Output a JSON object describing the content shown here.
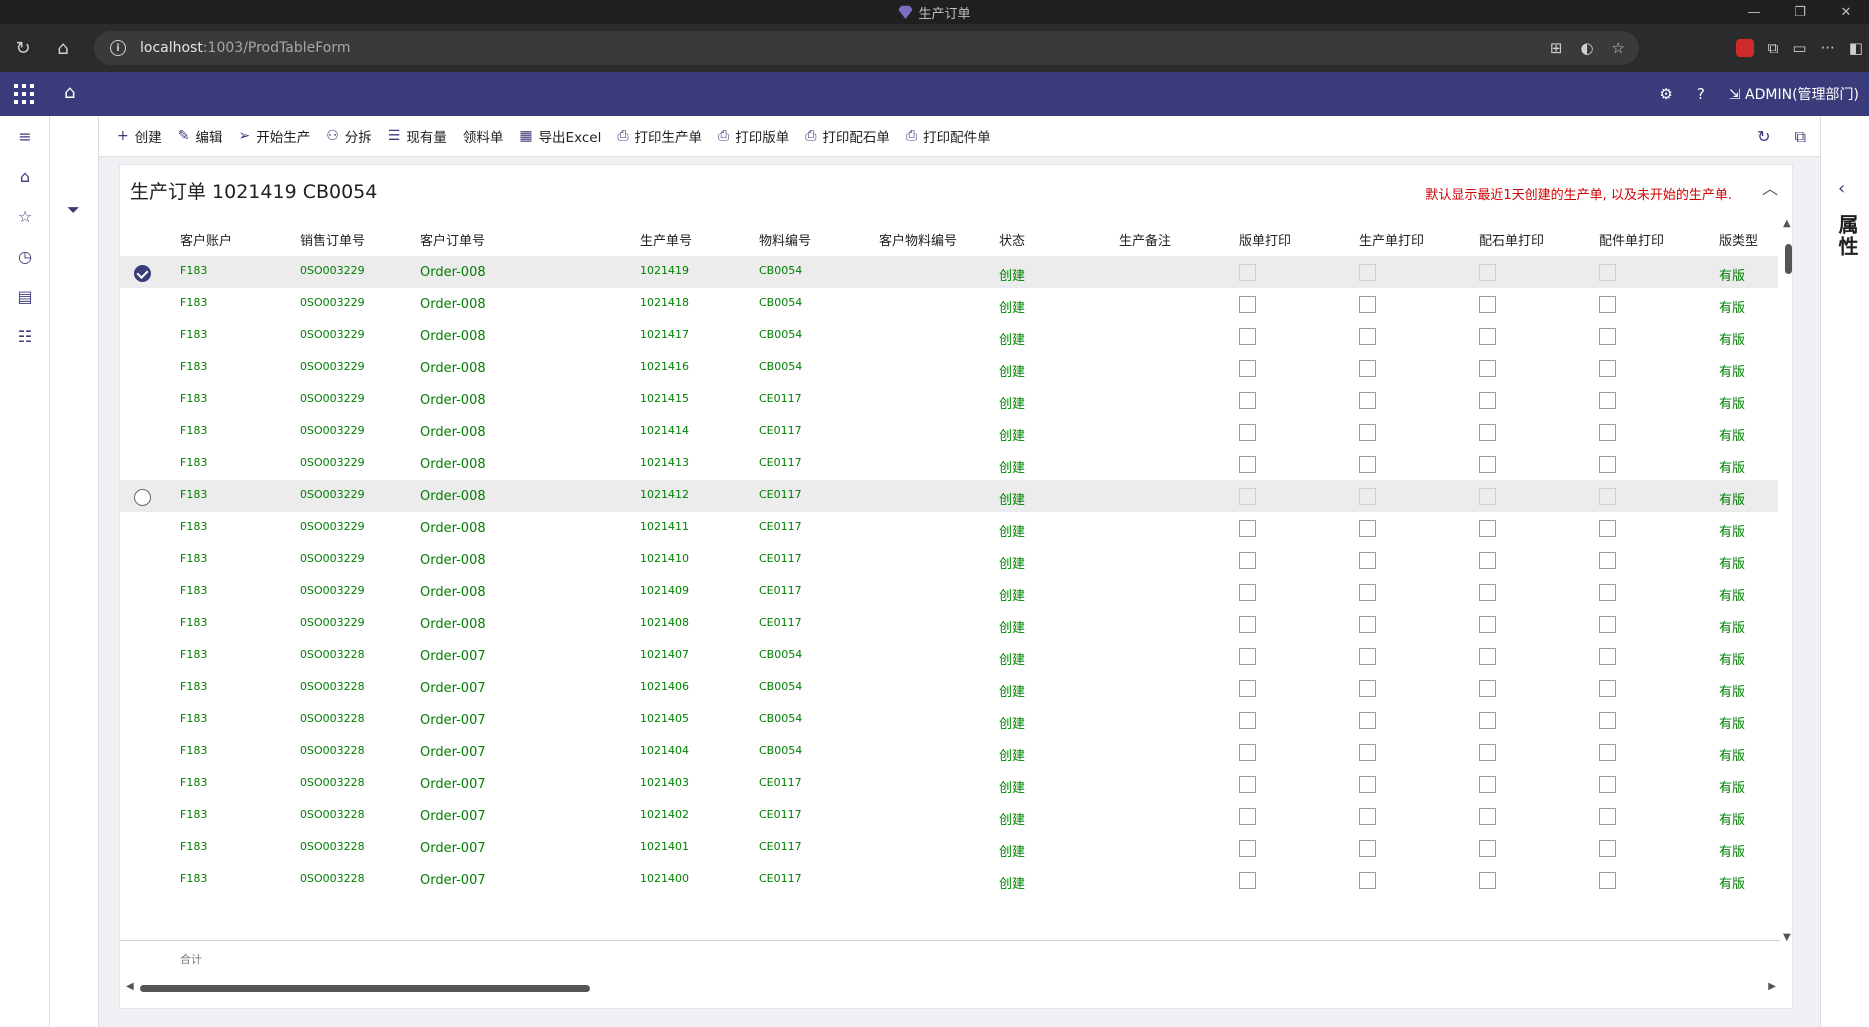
{
  "browser": {
    "window_title": "生产订单",
    "url_host": "localhost",
    "url_rest": ":1003/ProdTableForm"
  },
  "header": {
    "user": "ADMIN(管理部门)"
  },
  "actions": [
    {
      "label": "创建",
      "icon": "plus-icon",
      "glyph": "+"
    },
    {
      "label": "编辑",
      "icon": "pencil-icon",
      "glyph": "✎"
    },
    {
      "label": "开始生产",
      "icon": "send-icon",
      "glyph": "➢"
    },
    {
      "label": "分拆",
      "icon": "split-icon",
      "glyph": "⚇"
    },
    {
      "label": "现有量",
      "icon": "stock-icon",
      "glyph": "☰"
    },
    {
      "label": "领料单",
      "icon": "",
      "glyph": ""
    },
    {
      "label": "导出Excel",
      "icon": "excel-icon",
      "glyph": "▦"
    },
    {
      "label": "打印生产单",
      "icon": "print-icon",
      "glyph": "⎙"
    },
    {
      "label": "打印版单",
      "icon": "print-icon",
      "glyph": "⎙"
    },
    {
      "label": "打印配石单",
      "icon": "print-icon",
      "glyph": "⎙"
    },
    {
      "label": "打印配件单",
      "icon": "print-icon",
      "glyph": "⎙"
    }
  ],
  "right_pane_label": "属性",
  "form": {
    "title": "生产订单 1021419 CB0054",
    "notice": "默认显示最近1天创建的生产单, 以及未开始的生产单."
  },
  "columns": [
    "客户账户",
    "销售订单号",
    "客户订单号",
    "生产单号",
    "物料编号",
    "客户物料编号",
    "状态",
    "生产备注",
    "版单打印",
    "生产单打印",
    "配石单打印",
    "配件单打印",
    "版类型"
  ],
  "rows": [
    {
      "acct": "F183",
      "so": "0SO003229",
      "cust_order": "Order-008",
      "prod_no": "1021419",
      "item": "CB0054",
      "status": "创建",
      "type": "有版"
    },
    {
      "acct": "F183",
      "so": "0SO003229",
      "cust_order": "Order-008",
      "prod_no": "1021418",
      "item": "CB0054",
      "status": "创建",
      "type": "有版"
    },
    {
      "acct": "F183",
      "so": "0SO003229",
      "cust_order": "Order-008",
      "prod_no": "1021417",
      "item": "CB0054",
      "status": "创建",
      "type": "有版"
    },
    {
      "acct": "F183",
      "so": "0SO003229",
      "cust_order": "Order-008",
      "prod_no": "1021416",
      "item": "CB0054",
      "status": "创建",
      "type": "有版"
    },
    {
      "acct": "F183",
      "so": "0SO003229",
      "cust_order": "Order-008",
      "prod_no": "1021415",
      "item": "CE0117",
      "status": "创建",
      "type": "有版"
    },
    {
      "acct": "F183",
      "so": "0SO003229",
      "cust_order": "Order-008",
      "prod_no": "1021414",
      "item": "CE0117",
      "status": "创建",
      "type": "有版"
    },
    {
      "acct": "F183",
      "so": "0SO003229",
      "cust_order": "Order-008",
      "prod_no": "1021413",
      "item": "CE0117",
      "status": "创建",
      "type": "有版"
    },
    {
      "acct": "F183",
      "so": "0SO003229",
      "cust_order": "Order-008",
      "prod_no": "1021412",
      "item": "CE0117",
      "status": "创建",
      "type": "有版"
    },
    {
      "acct": "F183",
      "so": "0SO003229",
      "cust_order": "Order-008",
      "prod_no": "1021411",
      "item": "CE0117",
      "status": "创建",
      "type": "有版"
    },
    {
      "acct": "F183",
      "so": "0SO003229",
      "cust_order": "Order-008",
      "prod_no": "1021410",
      "item": "CE0117",
      "status": "创建",
      "type": "有版"
    },
    {
      "acct": "F183",
      "so": "0SO003229",
      "cust_order": "Order-008",
      "prod_no": "1021409",
      "item": "CE0117",
      "status": "创建",
      "type": "有版"
    },
    {
      "acct": "F183",
      "so": "0SO003229",
      "cust_order": "Order-008",
      "prod_no": "1021408",
      "item": "CE0117",
      "status": "创建",
      "type": "有版"
    },
    {
      "acct": "F183",
      "so": "0SO003228",
      "cust_order": "Order-007",
      "prod_no": "1021407",
      "item": "CB0054",
      "status": "创建",
      "type": "有版"
    },
    {
      "acct": "F183",
      "so": "0SO003228",
      "cust_order": "Order-007",
      "prod_no": "1021406",
      "item": "CB0054",
      "status": "创建",
      "type": "有版"
    },
    {
      "acct": "F183",
      "so": "0SO003228",
      "cust_order": "Order-007",
      "prod_no": "1021405",
      "item": "CB0054",
      "status": "创建",
      "type": "有版"
    },
    {
      "acct": "F183",
      "so": "0SO003228",
      "cust_order": "Order-007",
      "prod_no": "1021404",
      "item": "CB0054",
      "status": "创建",
      "type": "有版"
    },
    {
      "acct": "F183",
      "so": "0SO003228",
      "cust_order": "Order-007",
      "prod_no": "1021403",
      "item": "CE0117",
      "status": "创建",
      "type": "有版"
    },
    {
      "acct": "F183",
      "so": "0SO003228",
      "cust_order": "Order-007",
      "prod_no": "1021402",
      "item": "CE0117",
      "status": "创建",
      "type": "有版"
    },
    {
      "acct": "F183",
      "so": "0SO003228",
      "cust_order": "Order-007",
      "prod_no": "1021401",
      "item": "CE0117",
      "status": "创建",
      "type": "有版"
    },
    {
      "acct": "F183",
      "so": "0SO003228",
      "cust_order": "Order-007",
      "prod_no": "1021400",
      "item": "CE0117",
      "status": "创建",
      "type": "有版"
    }
  ],
  "selected_row": 0,
  "hover_row": 7,
  "footer": {
    "sum_label": "合计"
  },
  "colors": {
    "accent": "#3a3b7a",
    "data_text": "#008000",
    "notice": "#d10000"
  }
}
